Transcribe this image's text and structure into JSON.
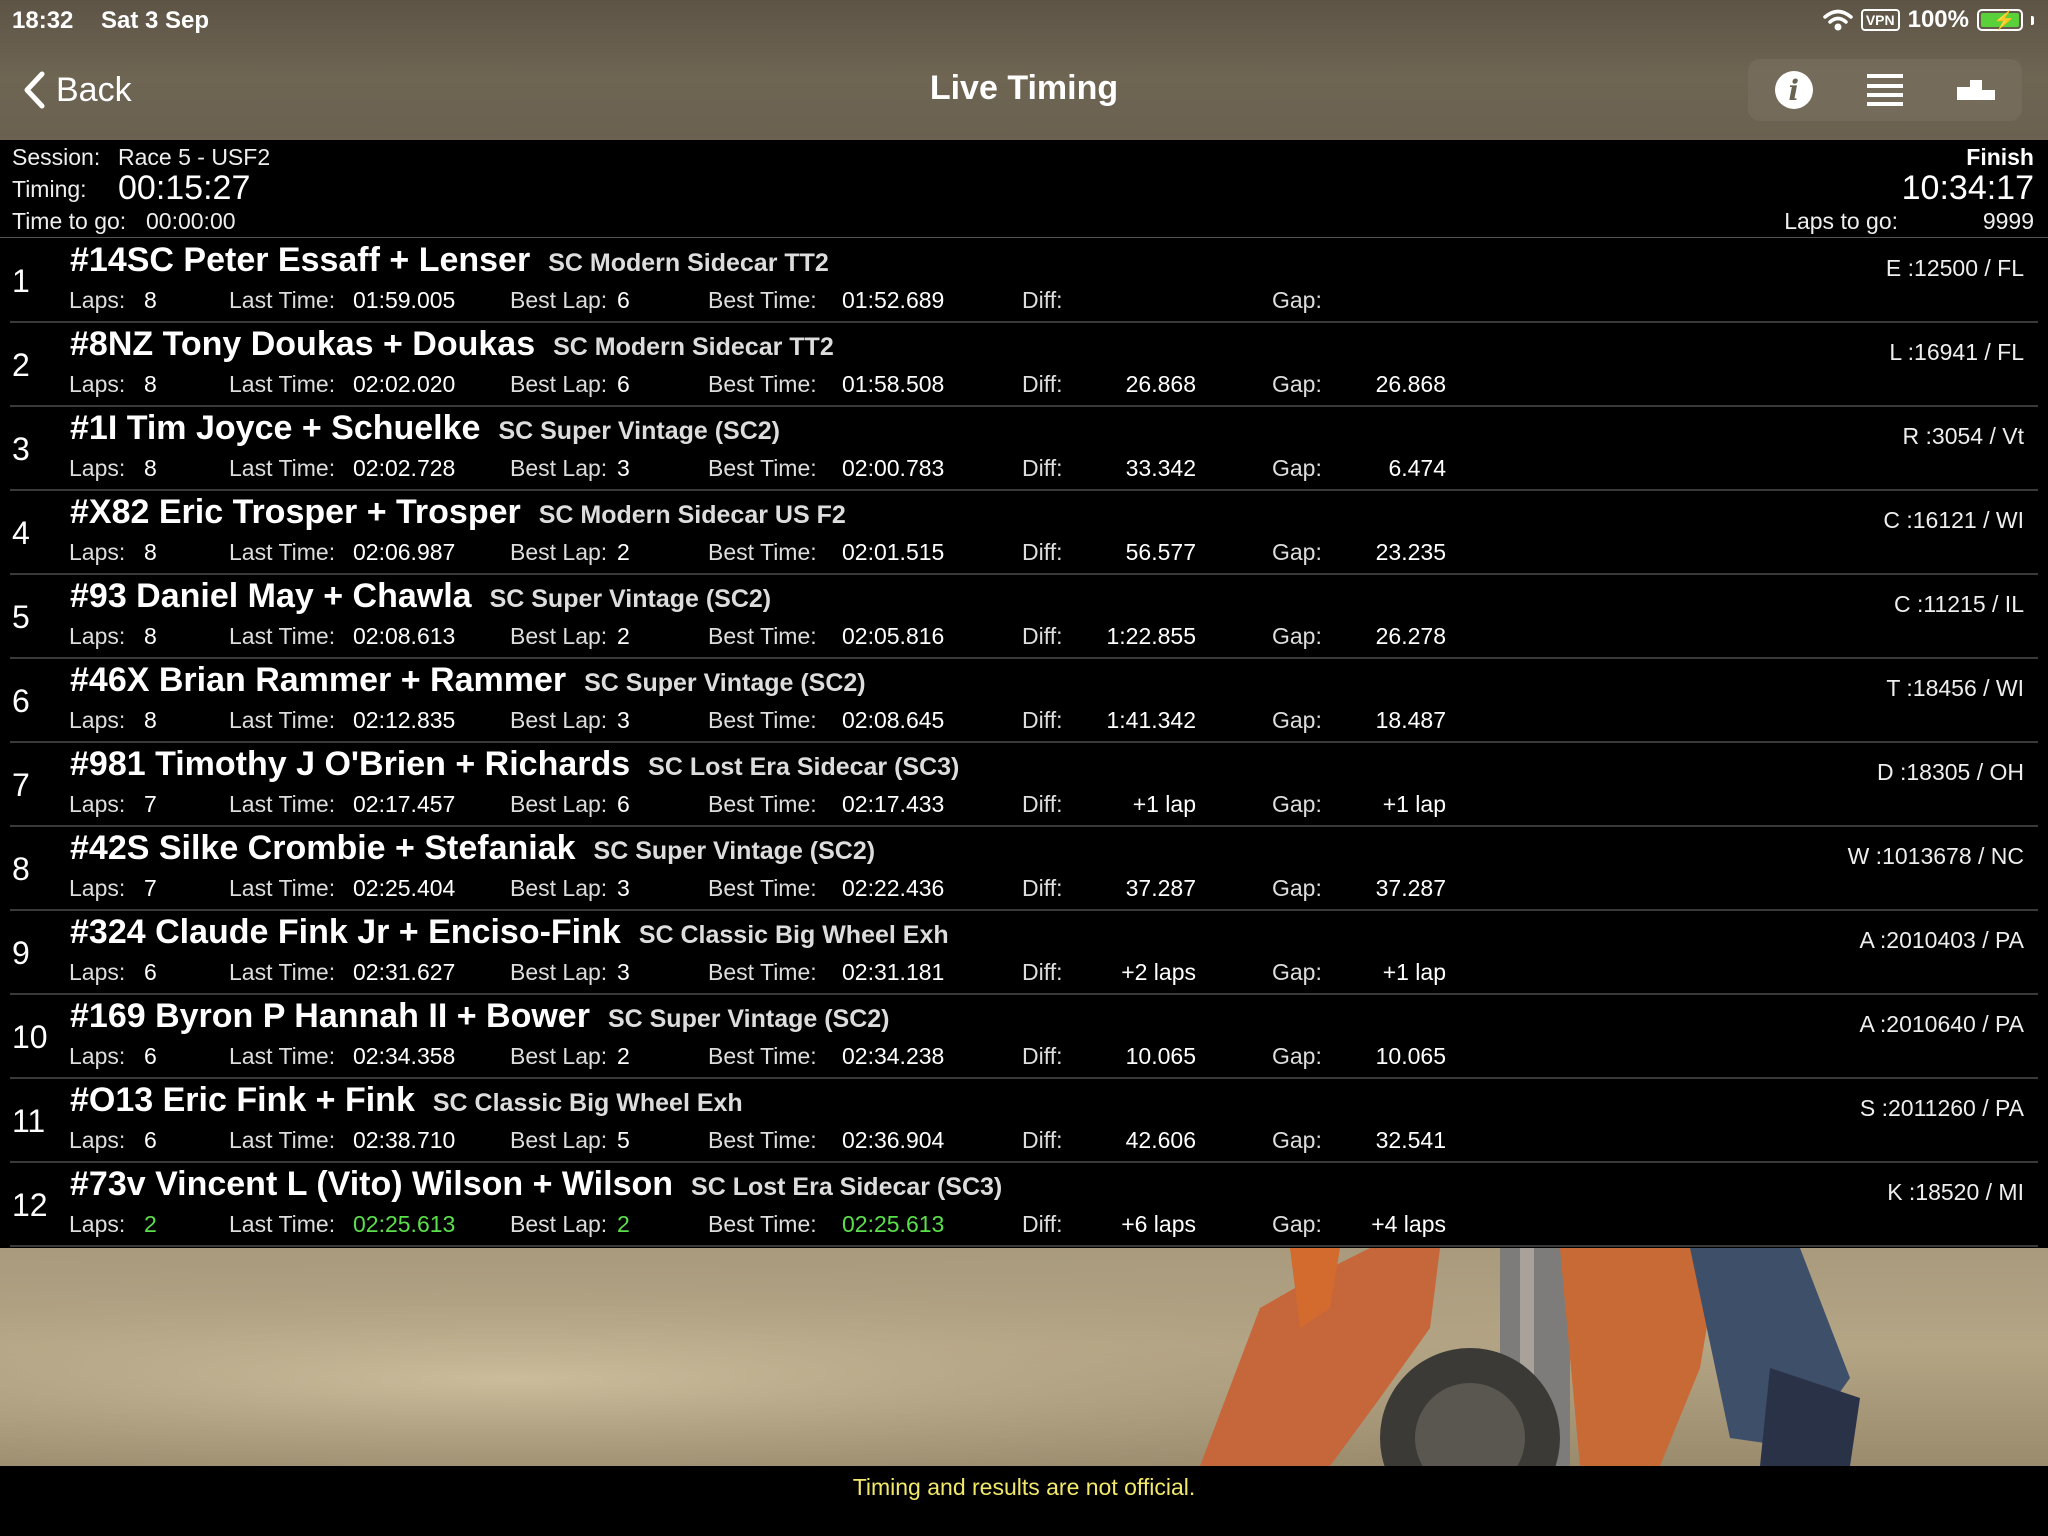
{
  "status_bar": {
    "time": "18:32",
    "date": "Sat 3 Sep",
    "vpn": "VPN",
    "battery": "100%",
    "icons": [
      "wifi-icon",
      "battery-charging-icon"
    ]
  },
  "nav": {
    "back_label": "Back",
    "title": "Live Timing",
    "tools": [
      "info-icon",
      "list-icon",
      "podium-icon"
    ]
  },
  "session": {
    "session_label": "Session:",
    "session_name": "Race 5 - USF2",
    "timing_label": "Timing:",
    "timing_value": "00:15:27",
    "time_to_go_label": "Time to go:",
    "time_to_go_value": "00:00:00",
    "finish_label": "Finish",
    "finish_time": "10:34:17",
    "laps_to_go_label": "Laps to go:",
    "laps_to_go_value": "9999"
  },
  "labels": {
    "laps": "Laps:",
    "last_time": "Last Time:",
    "best_lap": "Best Lap:",
    "best_time": "Best Time:",
    "diff": "Diff:",
    "gap": "Gap:"
  },
  "rows": [
    {
      "pos": "1",
      "name": "#14SC Peter Essaff + Lenser",
      "class": "SC Modern Sidecar TT2",
      "reg": "E :12500 / FL",
      "laps": "8",
      "last_time": "01:59.005",
      "best_lap": "6",
      "best_time": "01:52.689",
      "diff": "",
      "gap": ""
    },
    {
      "pos": "2",
      "name": "#8NZ Tony Doukas + Doukas",
      "class": "SC Modern Sidecar TT2",
      "reg": "L :16941 / FL",
      "laps": "8",
      "last_time": "02:02.020",
      "best_lap": "6",
      "best_time": "01:58.508",
      "diff": "26.868",
      "gap": "26.868"
    },
    {
      "pos": "3",
      "name": "#1I Tim Joyce + Schuelke",
      "class": "SC Super Vintage (SC2)",
      "reg": "R :3054 / Vt",
      "laps": "8",
      "last_time": "02:02.728",
      "best_lap": "3",
      "best_time": "02:00.783",
      "diff": "33.342",
      "gap": "6.474"
    },
    {
      "pos": "4",
      "name": "#X82 Eric Trosper + Trosper",
      "class": "SC Modern Sidecar US F2",
      "reg": "C :16121 / WI",
      "laps": "8",
      "last_time": "02:06.987",
      "best_lap": "2",
      "best_time": "02:01.515",
      "diff": "56.577",
      "gap": "23.235"
    },
    {
      "pos": "5",
      "name": "#93 Daniel May + Chawla",
      "class": "SC Super Vintage (SC2)",
      "reg": "C :11215 / IL",
      "laps": "8",
      "last_time": "02:08.613",
      "best_lap": "2",
      "best_time": "02:05.816",
      "diff": "1:22.855",
      "gap": "26.278"
    },
    {
      "pos": "6",
      "name": "#46X Brian Rammer + Rammer",
      "class": "SC Super Vintage (SC2)",
      "reg": "T :18456 / WI",
      "laps": "8",
      "last_time": "02:12.835",
      "best_lap": "3",
      "best_time": "02:08.645",
      "diff": "1:41.342",
      "gap": "18.487"
    },
    {
      "pos": "7",
      "name": "#981 Timothy J O'Brien + Richards",
      "class": "SC Lost Era Sidecar (SC3)",
      "reg": "D :18305 / OH",
      "laps": "7",
      "last_time": "02:17.457",
      "best_lap": "6",
      "best_time": "02:17.433",
      "diff": "+1 lap",
      "gap": "+1 lap"
    },
    {
      "pos": "8",
      "name": "#42S Silke Crombie + Stefaniak",
      "class": "SC Super Vintage (SC2)",
      "reg": "W :1013678 / NC",
      "laps": "7",
      "last_time": "02:25.404",
      "best_lap": "3",
      "best_time": "02:22.436",
      "diff": "37.287",
      "gap": "37.287"
    },
    {
      "pos": "9",
      "name": "#324 Claude Fink Jr + Enciso-Fink",
      "class": "SC Classic Big Wheel Exh",
      "reg": "A :2010403 / PA",
      "laps": "6",
      "last_time": "02:31.627",
      "best_lap": "3",
      "best_time": "02:31.181",
      "diff": "+2 laps",
      "gap": "+1 lap"
    },
    {
      "pos": "10",
      "name": "#169 Byron P Hannah II + Bower",
      "class": "SC Super Vintage (SC2)",
      "reg": "A :2010640 / PA",
      "laps": "6",
      "last_time": "02:34.358",
      "best_lap": "2",
      "best_time": "02:34.238",
      "diff": "10.065",
      "gap": "10.065"
    },
    {
      "pos": "11",
      "name": "#O13 Eric Fink + Fink",
      "class": "SC Classic Big Wheel Exh",
      "reg": "S :2011260 / PA",
      "laps": "6",
      "last_time": "02:38.710",
      "best_lap": "5",
      "best_time": "02:36.904",
      "diff": "42.606",
      "gap": "32.541"
    },
    {
      "pos": "12",
      "name": "#73v Vincent L (Vito) Wilson + Wilson",
      "class": "SC Lost Era Sidecar (SC3)",
      "reg": "K :18520 / MI",
      "laps": "2",
      "last_time": "02:25.613",
      "best_lap": "2",
      "best_time": "02:25.613",
      "diff": "+6 laps",
      "gap": "+4 laps",
      "highlight": true
    }
  ],
  "footer": {
    "disclaimer": "Timing and results are not official."
  },
  "colors": {
    "header_bg": "#6a6150",
    "highlight_green": "#5ae04a",
    "disclaimer_yellow": "#f2e86a"
  }
}
